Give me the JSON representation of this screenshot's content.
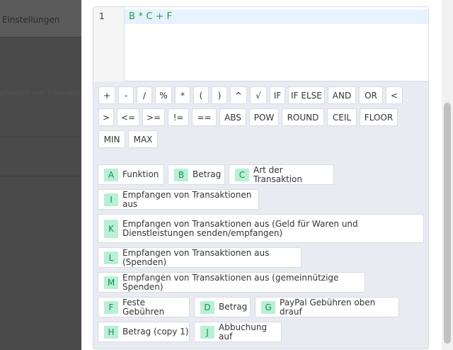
{
  "background": {
    "settings_label": "Einstellungen",
    "faint_text": "pfangen von Transaktionen aus"
  },
  "editor": {
    "line_number": "1",
    "expression": "B * C + F"
  },
  "operators": [
    "+",
    "-",
    "/",
    "%",
    "*",
    "(",
    ")",
    "^",
    "√",
    "IF",
    "IF ELSE",
    "AND",
    "OR",
    "<",
    ">",
    "<=",
    ">=",
    "!=",
    "==",
    "ABS",
    "POW",
    "ROUND",
    "CEIL",
    "FLOOR",
    "MIN",
    "MAX"
  ],
  "variables": [
    {
      "letter": "A",
      "label": "Funktion"
    },
    {
      "letter": "B",
      "label": "Betrag"
    },
    {
      "letter": "C",
      "label": "Art der Transaktion"
    },
    {
      "letter": "I",
      "label": "Empfangen von Transaktionen aus"
    },
    {
      "letter": "K",
      "label": "Empfangen von Transaktionen aus (Geld für Waren und Dienstleistungen senden/empfangen)"
    },
    {
      "letter": "L",
      "label": "Empfangen von Transaktionen aus (Spenden)"
    },
    {
      "letter": "M",
      "label": "Empfangen von Transaktionen aus (gemeinnützige Spenden)"
    },
    {
      "letter": "F",
      "label": "Feste Gebühren"
    },
    {
      "letter": "D",
      "label": "Betrag"
    },
    {
      "letter": "G",
      "label": "PayPal Gebühren oben drauf"
    },
    {
      "letter": "H",
      "label": "Betrag (copy 1)"
    },
    {
      "letter": "J",
      "label": "Abbuchung auf"
    }
  ]
}
